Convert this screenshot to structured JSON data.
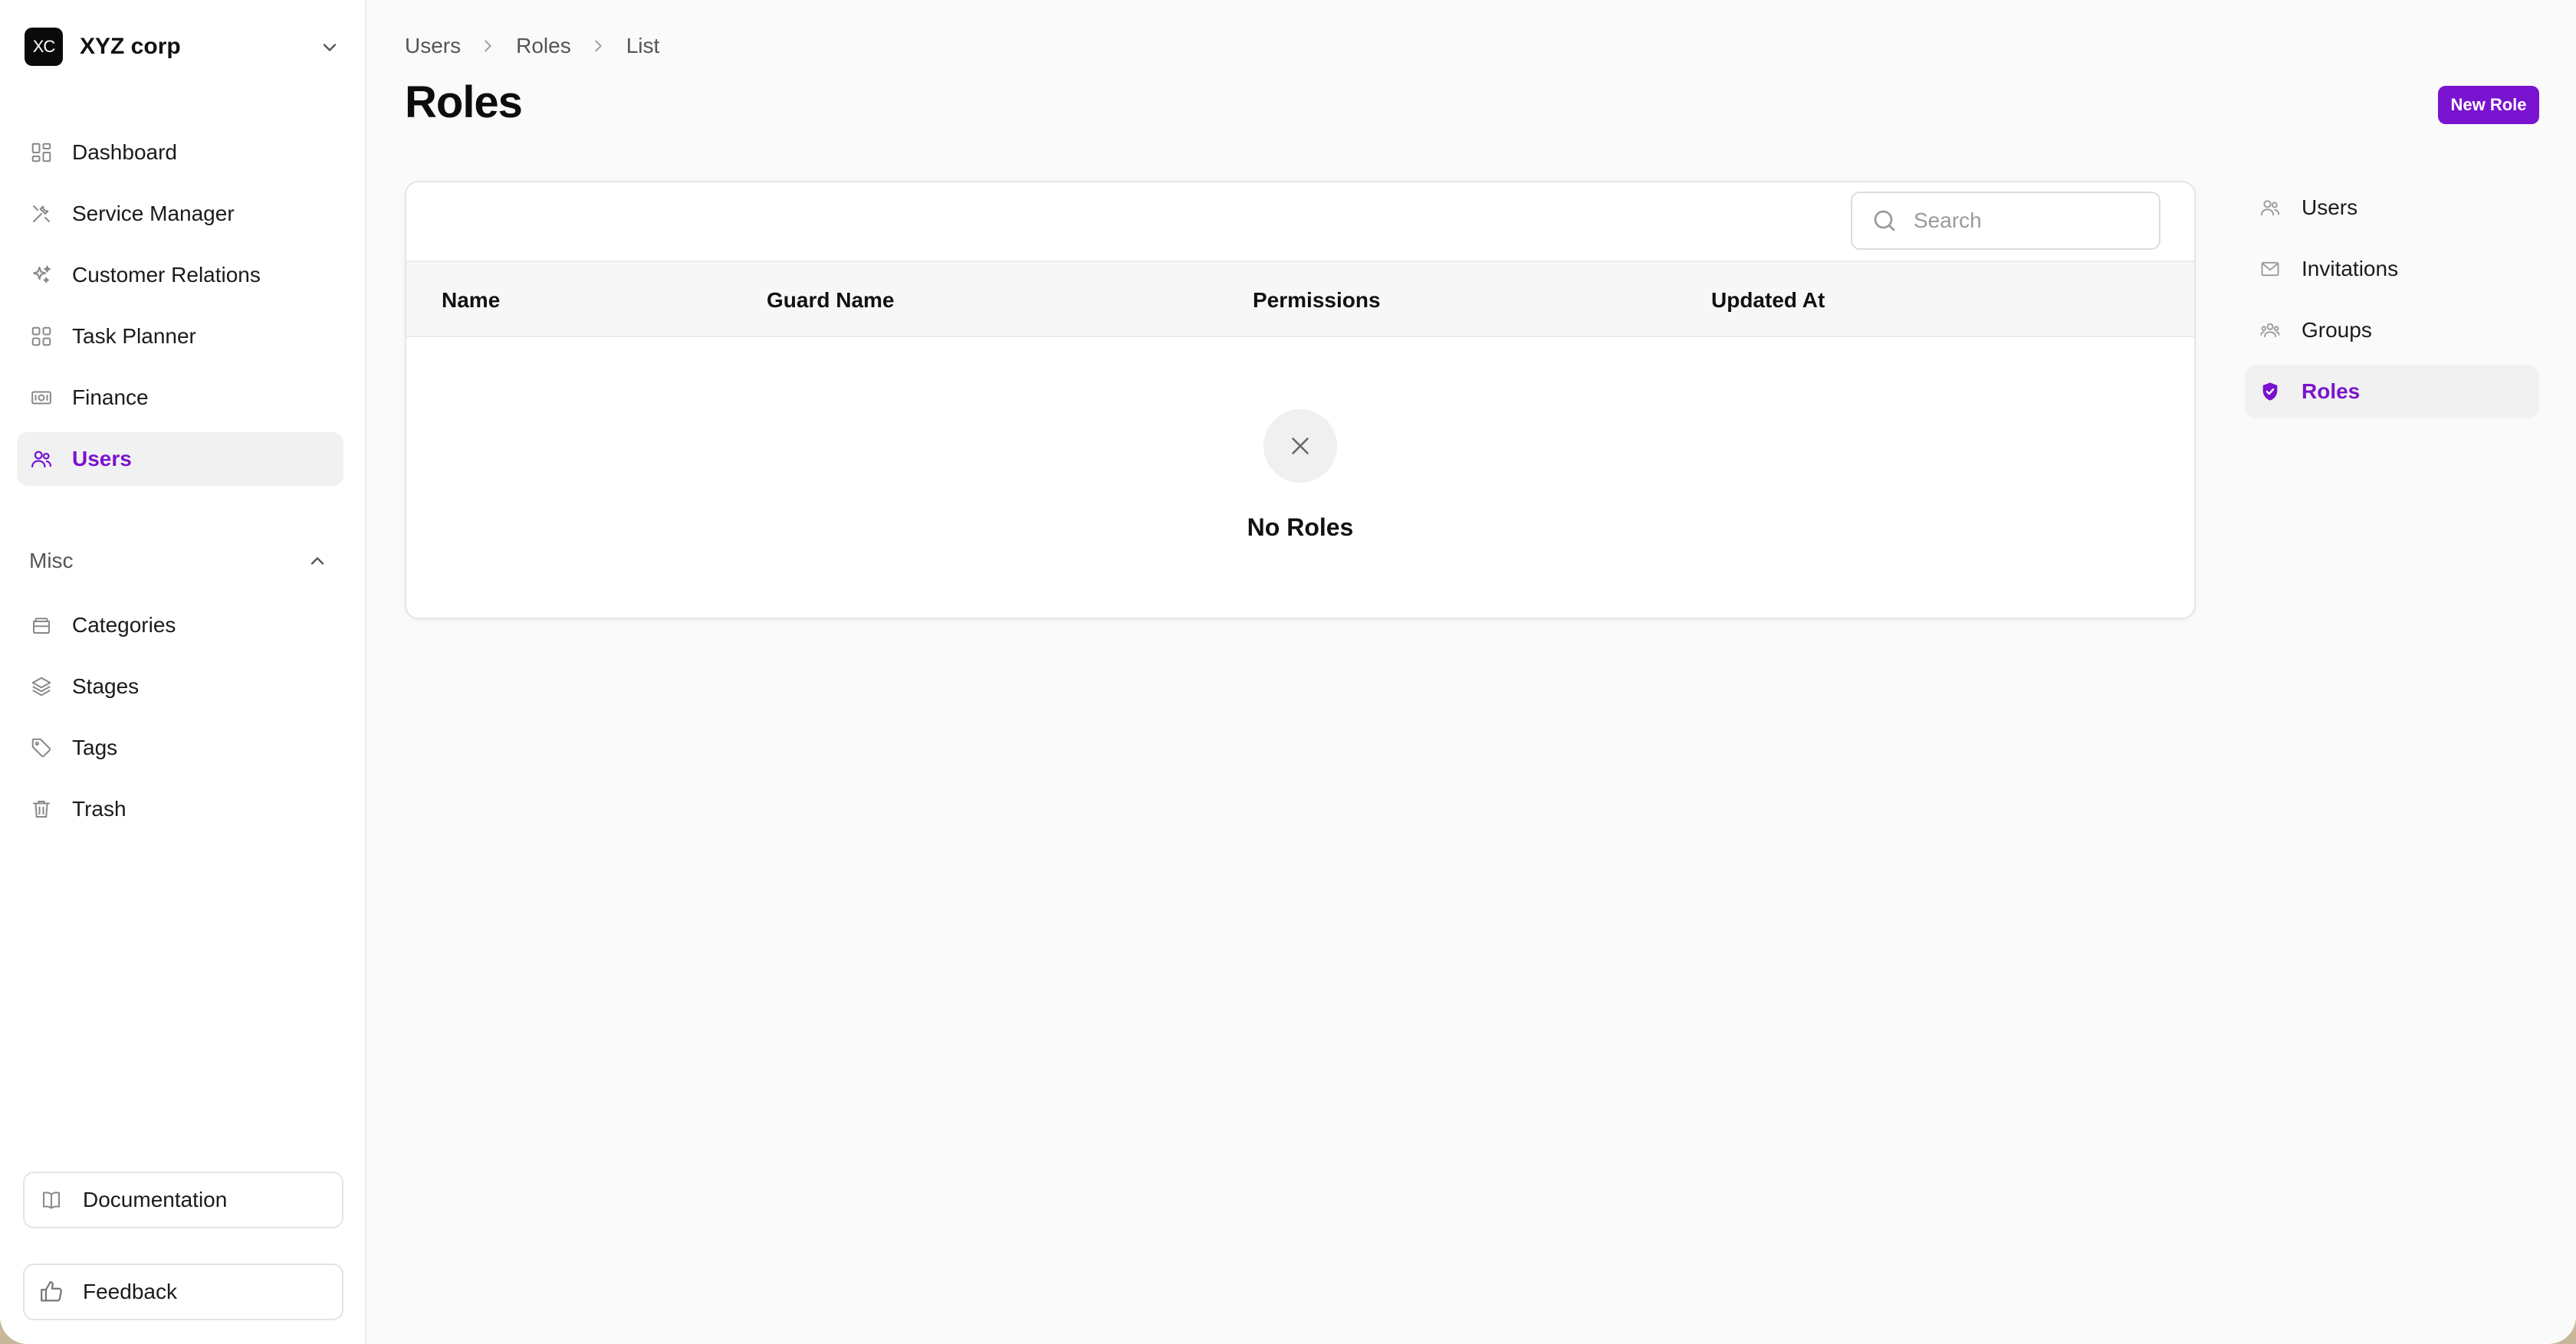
{
  "org": {
    "initials": "XC",
    "name": "XYZ corp"
  },
  "sidebar": {
    "items": [
      {
        "label": "Dashboard",
        "icon": "dashboard-icon"
      },
      {
        "label": "Service Manager",
        "icon": "tools-icon"
      },
      {
        "label": "Customer Relations",
        "icon": "sparkles-icon"
      },
      {
        "label": "Task Planner",
        "icon": "grid-icon"
      },
      {
        "label": "Finance",
        "icon": "banknote-icon"
      },
      {
        "label": "Users",
        "icon": "users-icon",
        "active": true
      }
    ],
    "misc_label": "Misc",
    "misc_items": [
      {
        "label": "Categories",
        "icon": "folder-icon"
      },
      {
        "label": "Stages",
        "icon": "layers-icon"
      },
      {
        "label": "Tags",
        "icon": "tag-icon"
      },
      {
        "label": "Trash",
        "icon": "trash-icon"
      }
    ],
    "documentation_label": "Documentation",
    "feedback_label": "Feedback"
  },
  "breadcrumb": [
    "Users",
    "Roles",
    "List"
  ],
  "page_title": "Roles",
  "new_button_label": "New Role",
  "search": {
    "placeholder": "Search"
  },
  "table": {
    "columns": [
      "Name",
      "Guard Name",
      "Permissions",
      "Updated At"
    ],
    "rows": [],
    "empty_text": "No Roles"
  },
  "subnav": {
    "items": [
      {
        "label": "Users",
        "icon": "users-icon"
      },
      {
        "label": "Invitations",
        "icon": "envelope-icon"
      },
      {
        "label": "Groups",
        "icon": "user-group-icon"
      },
      {
        "label": "Roles",
        "icon": "shield-check-icon",
        "active": true
      }
    ]
  },
  "colors": {
    "accent": "#7a13cf",
    "background": "#fafafa",
    "sidebar": "#ffffff"
  }
}
